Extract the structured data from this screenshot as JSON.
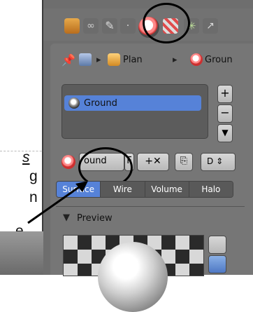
{
  "tutorial": {
    "line1": "s",
    "line2": "g",
    "line3": "n",
    "line4": "e."
  },
  "breadcrumb": {
    "item1": "Plan",
    "item2": "Groun"
  },
  "material_slot": {
    "name": "Ground"
  },
  "datablock": {
    "name_partial": "ound",
    "f_label": "F",
    "user_label": "D"
  },
  "material_type_tabs": [
    "Surface",
    "Wire",
    "Volume",
    "Halo"
  ],
  "preview": {
    "label": "Preview"
  }
}
